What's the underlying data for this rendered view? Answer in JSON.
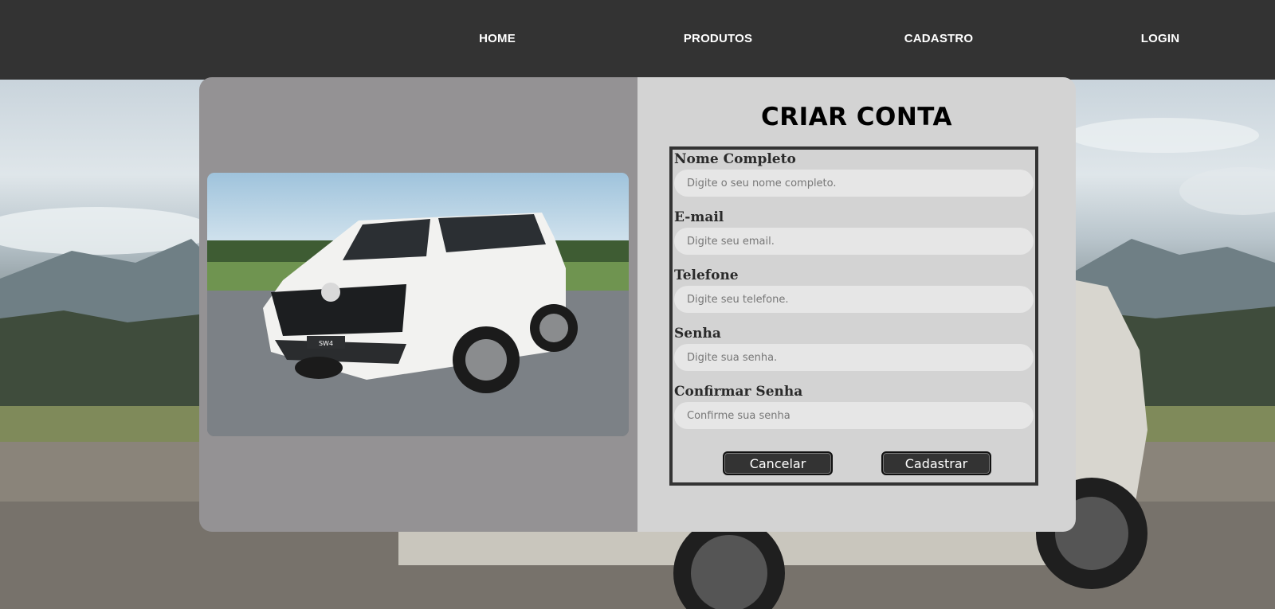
{
  "nav": {
    "items": [
      {
        "label": "HOME"
      },
      {
        "label": "PRODUTOS"
      },
      {
        "label": "CADASTRO"
      },
      {
        "label": "LOGIN"
      }
    ]
  },
  "form": {
    "title": "CRIAR CONTA",
    "fields": [
      {
        "label": "Nome Completo",
        "placeholder": "Digite o seu nome completo.",
        "value": ""
      },
      {
        "label": "E-mail",
        "placeholder": "Digite seu email.",
        "value": ""
      },
      {
        "label": "Telefone",
        "placeholder": "Digite seu telefone.",
        "value": ""
      },
      {
        "label": "Senha",
        "placeholder": "Digite sua senha.",
        "value": ""
      },
      {
        "label": "Confirmar Senha",
        "placeholder": "Confirme sua senha",
        "value": ""
      }
    ],
    "cancel_label": "Cancelar",
    "submit_label": "Cadastrar"
  },
  "colors": {
    "navbar": "#333333",
    "card_left": "#949294",
    "card_right": "#d3d3d3",
    "button": "#333333"
  },
  "images": {
    "hero_car": "white-toyota-sw4-suv-photo",
    "background": "mountain-landscape-with-suv"
  }
}
